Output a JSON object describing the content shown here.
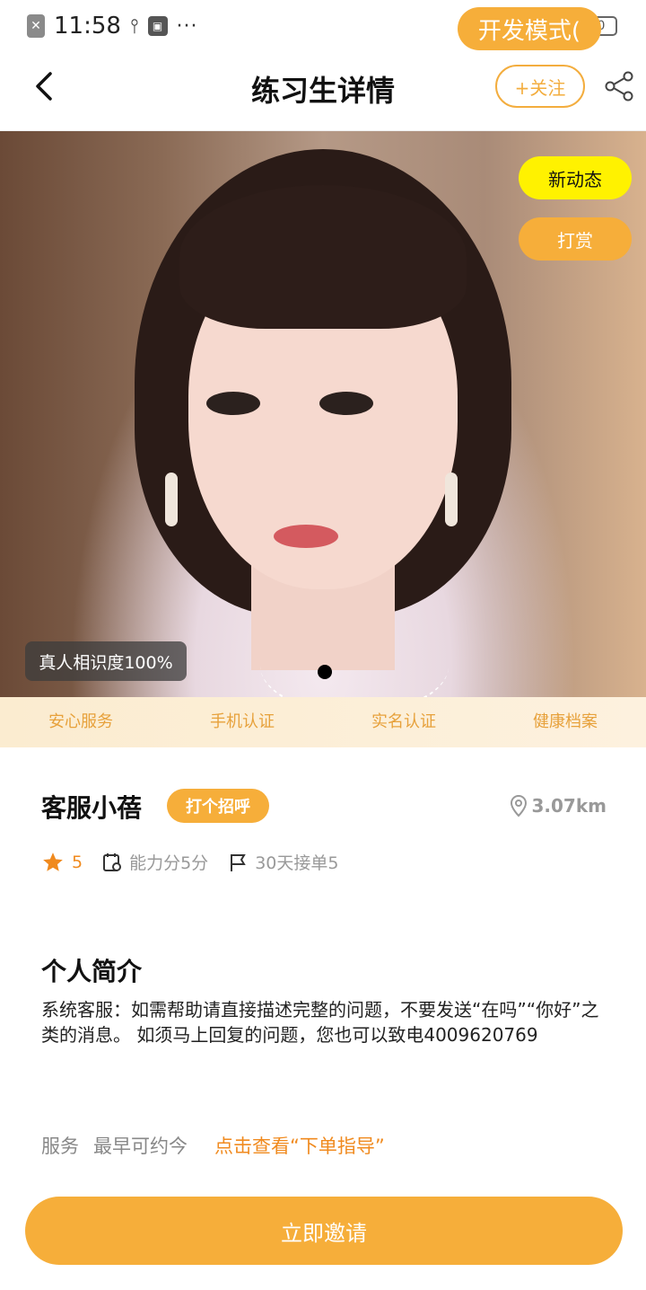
{
  "status_bar": {
    "time": "11:58",
    "dots": "···",
    "battery": "100"
  },
  "dev_mode_label": "开发模式(",
  "header": {
    "title": "练习生详情",
    "follow_label": "+关注"
  },
  "hero": {
    "news_label": "新动态",
    "tip_label": "打赏",
    "similarity_label": "真人相识度100%"
  },
  "badges": [
    "安心服务",
    "手机认证",
    "实名认证",
    "健康档案"
  ],
  "profile": {
    "name": "客服小蓓",
    "greet_label": "打个招呼",
    "distance": "3.07km",
    "rating": "5",
    "ability": "能力分5分",
    "orders_30d": "30天接单5"
  },
  "intro": {
    "title": "个人简介",
    "text": "系统客服：如需帮助请直接描述完整的问题，不要发送“在吗”“你好”之类的消息。 如须马上回复的问题，您也可以致电4009620769"
  },
  "service": {
    "label": "服务",
    "earliest": "最早可约今",
    "guide_link": "点击查看“下单指导”"
  },
  "invite_label": "立即邀请",
  "colors": {
    "accent": "#f6ae3a",
    "news_yellow": "#fff200",
    "link_orange": "#f08a1e"
  }
}
